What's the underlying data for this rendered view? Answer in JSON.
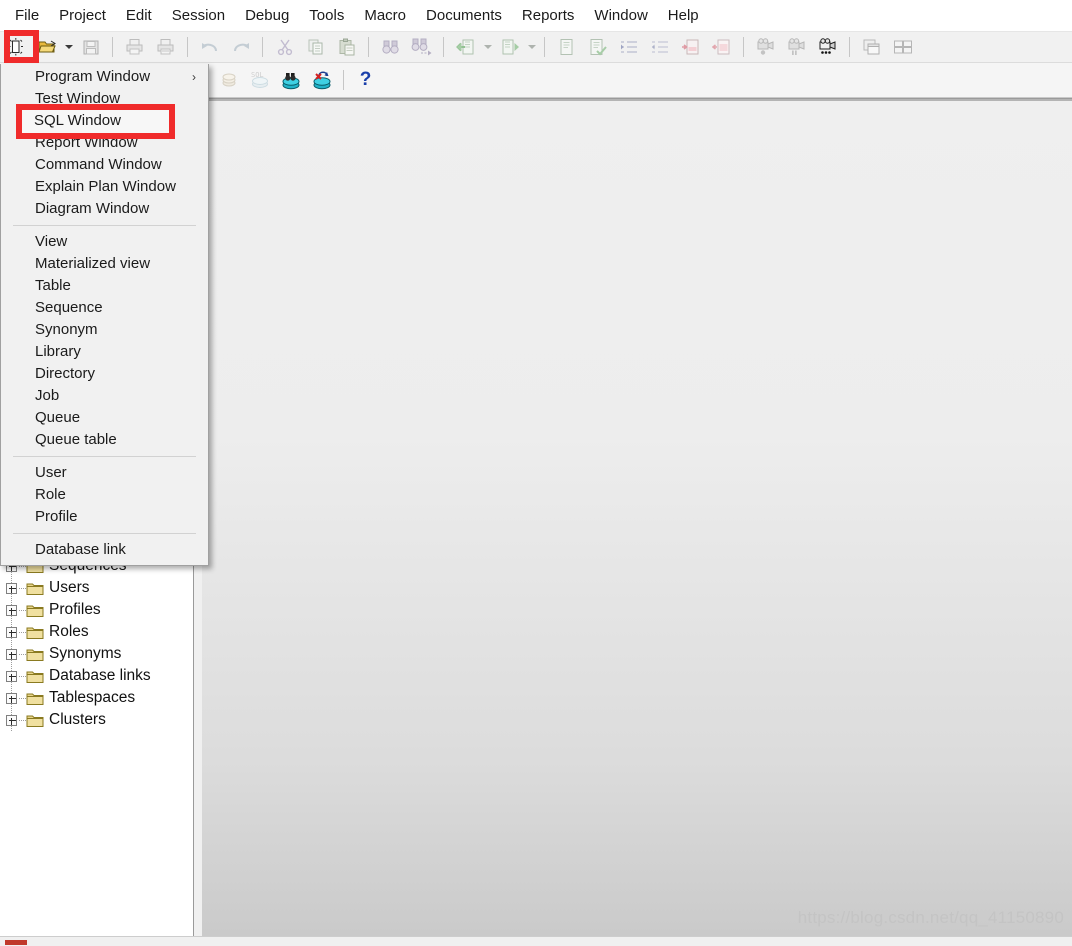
{
  "menubar": {
    "items": [
      {
        "label": "File"
      },
      {
        "label": "Project"
      },
      {
        "label": "Edit"
      },
      {
        "label": "Session"
      },
      {
        "label": "Debug"
      },
      {
        "label": "Tools"
      },
      {
        "label": "Macro"
      },
      {
        "label": "Documents"
      },
      {
        "label": "Reports"
      },
      {
        "label": "Window"
      },
      {
        "label": "Help"
      }
    ]
  },
  "toolbar1": {
    "buttons": [
      {
        "name": "new-document-icon",
        "tooltip": "New",
        "enabled": true
      },
      {
        "name": "open-folder-icon",
        "tooltip": "Open",
        "enabled": true
      },
      {
        "name": "open-dropdown-arrow",
        "tooltip": "Open recent",
        "enabled": true
      },
      {
        "name": "save-disk-icon",
        "tooltip": "Save",
        "enabled": false
      },
      {
        "name": "print-icon",
        "tooltip": "Print",
        "enabled": false
      },
      {
        "name": "print-preview-icon",
        "tooltip": "Print preview",
        "enabled": false
      },
      {
        "name": "undo-arrow-icon",
        "tooltip": "Undo",
        "enabled": false
      },
      {
        "name": "redo-arrow-icon",
        "tooltip": "Redo",
        "enabled": false
      },
      {
        "name": "cut-scissors-icon",
        "tooltip": "Cut",
        "enabled": false
      },
      {
        "name": "copy-icon",
        "tooltip": "Copy",
        "enabled": false
      },
      {
        "name": "paste-clipboard-icon",
        "tooltip": "Paste",
        "enabled": false
      },
      {
        "name": "find-binoculars-icon",
        "tooltip": "Find",
        "enabled": false
      },
      {
        "name": "find-next-binoculars-icon",
        "tooltip": "Find next",
        "enabled": false
      },
      {
        "name": "previous-page-icon",
        "tooltip": "Previous",
        "enabled": false
      },
      {
        "name": "previous-dropdown-arrow",
        "tooltip": "Previous list",
        "enabled": false
      },
      {
        "name": "next-page-icon",
        "tooltip": "Next",
        "enabled": false
      },
      {
        "name": "next-dropdown-arrow",
        "tooltip": "Next list",
        "enabled": false
      },
      {
        "name": "execute-document-icon",
        "tooltip": "Execute",
        "enabled": false
      },
      {
        "name": "check-document-icon",
        "tooltip": "Check",
        "enabled": false
      },
      {
        "name": "indent-increase-icon",
        "tooltip": "Indent",
        "enabled": false
      },
      {
        "name": "indent-decrease-icon",
        "tooltip": "Outdent",
        "enabled": false
      },
      {
        "name": "step-into-icon",
        "tooltip": "Step into",
        "enabled": false
      },
      {
        "name": "step-out-icon",
        "tooltip": "Step out",
        "enabled": false
      },
      {
        "name": "record-camera-icon",
        "tooltip": "Record macro",
        "enabled": false
      },
      {
        "name": "pause-camera-icon",
        "tooltip": "Pause macro",
        "enabled": false
      },
      {
        "name": "play-camera-icon",
        "tooltip": "Play macro",
        "enabled": true
      },
      {
        "name": "cascade-windows-icon",
        "tooltip": "Cascade",
        "enabled": false
      },
      {
        "name": "tile-windows-icon",
        "tooltip": "Tile",
        "enabled": false
      }
    ]
  },
  "toolbar2": {
    "buttons": [
      {
        "name": "commit-coin-icon",
        "tooltip": "Commit",
        "enabled": false
      },
      {
        "name": "rollback-sql-icon",
        "tooltip": "Rollback",
        "enabled": false
      },
      {
        "name": "session-connect-icon",
        "tooltip": "Test connection",
        "enabled": true
      },
      {
        "name": "session-disconnect-icon",
        "tooltip": "Log off",
        "enabled": true
      },
      {
        "name": "help-question-icon",
        "tooltip": "Help",
        "label": "?",
        "enabled": true
      }
    ]
  },
  "dropdown": {
    "name": "new-object-menu",
    "groups": [
      {
        "items": [
          {
            "label": "Program Window",
            "submenu": true,
            "arrow": "›"
          },
          {
            "label": "Test Window",
            "submenu": false
          },
          {
            "label": "SQL Window",
            "submenu": false,
            "highlighted": true
          },
          {
            "label": "Report Window",
            "submenu": false
          },
          {
            "label": "Command Window",
            "submenu": false
          },
          {
            "label": "Explain Plan Window",
            "submenu": false
          },
          {
            "label": "Diagram Window",
            "submenu": false
          }
        ]
      },
      {
        "items": [
          {
            "label": "View",
            "submenu": false
          },
          {
            "label": "Materialized view",
            "submenu": false
          },
          {
            "label": "Table",
            "submenu": false
          },
          {
            "label": "Sequence",
            "submenu": false
          },
          {
            "label": "Synonym",
            "submenu": false
          },
          {
            "label": "Library",
            "submenu": false
          },
          {
            "label": "Directory",
            "submenu": false
          },
          {
            "label": "Job",
            "submenu": false
          },
          {
            "label": "Queue",
            "submenu": false
          },
          {
            "label": "Queue table",
            "submenu": false
          }
        ]
      },
      {
        "items": [
          {
            "label": "User",
            "submenu": false
          },
          {
            "label": "Role",
            "submenu": false
          },
          {
            "label": "Profile",
            "submenu": false
          }
        ]
      },
      {
        "items": [
          {
            "label": "Database link",
            "submenu": false
          }
        ]
      }
    ]
  },
  "sidebar": {
    "name": "object-browser-tree",
    "items": [
      {
        "label": "Sequences",
        "icon": "folder-icon",
        "expandable": true
      },
      {
        "label": "Users",
        "icon": "folder-icon",
        "expandable": true
      },
      {
        "label": "Profiles",
        "icon": "folder-icon",
        "expandable": true
      },
      {
        "label": "Roles",
        "icon": "folder-icon",
        "expandable": true
      },
      {
        "label": "Synonyms",
        "icon": "folder-icon",
        "expandable": true
      },
      {
        "label": "Database links",
        "icon": "folder-icon",
        "expandable": true
      },
      {
        "label": "Tablespaces",
        "icon": "folder-icon",
        "expandable": true
      },
      {
        "label": "Clusters",
        "icon": "folder-icon",
        "expandable": true
      }
    ]
  },
  "workspace": {
    "watermark": "https://blog.csdn.net/qq_41150890"
  },
  "annotations": [
    {
      "name": "annotation-new-toolbar-button",
      "color": "#f02b2b",
      "target": "new-document-icon"
    },
    {
      "name": "annotation-sql-window-menu-item",
      "color": "#f02b2b",
      "target": "SQL Window"
    }
  ],
  "colors": {
    "annotation_red": "#f02b2b",
    "menu_bg": "#f1f1f1",
    "toolbar_bg": "#f1f1f1",
    "workspace_top": "#efefef",
    "workspace_bottom": "#c9c9c9",
    "folder_yellow": "#f2d16b",
    "watermark_gray": "#c4c4c4"
  }
}
